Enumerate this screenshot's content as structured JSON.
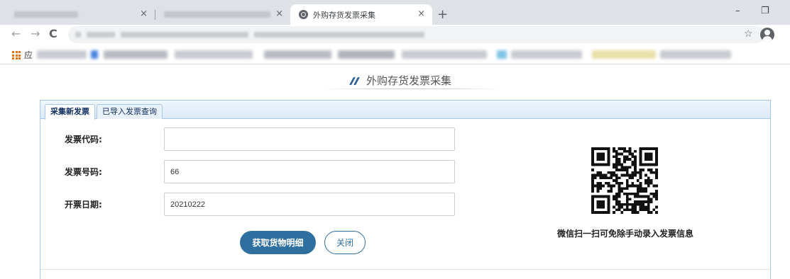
{
  "browser": {
    "tabs": [
      {
        "title": "",
        "blurred": true,
        "close": "×"
      },
      {
        "title": "",
        "blurred": true,
        "close": "×"
      },
      {
        "title": "外购存货发票采集",
        "active": true,
        "close": "×"
      }
    ],
    "new_tab": "+",
    "window_controls": {
      "minimize": "–",
      "restore": "❐"
    },
    "nav": {
      "back": "←",
      "forward": "→",
      "reload": "C"
    },
    "bookmark_star": "☆",
    "apps_label": "应"
  },
  "page": {
    "title": "外购存货发票采集"
  },
  "panel": {
    "tabs": [
      {
        "label": "采集新发票",
        "active": true
      },
      {
        "label": "已导入发票查询",
        "active": false
      }
    ],
    "form": {
      "invoice_code": {
        "label": "发票代码:",
        "value": ""
      },
      "invoice_number": {
        "label": "发票号码:",
        "value": "66"
      },
      "invoice_date": {
        "label": "开票日期:",
        "value": "20210222"
      }
    },
    "buttons": {
      "fetch_details": "获取货物明细",
      "close": "关闭"
    },
    "qr_caption": "微信扫一扫可免除手动录入发票信息"
  },
  "colors": {
    "primary": "#2f6f9f",
    "panel_border": "#a9c8e6",
    "title_icon": "#2b5f93"
  },
  "icons": [
    "globe-favicon-icon",
    "back-arrow-icon",
    "forward-arrow-icon",
    "reload-icon",
    "star-icon",
    "profile-icon",
    "apps-grid-icon",
    "qr-code-icon"
  ]
}
